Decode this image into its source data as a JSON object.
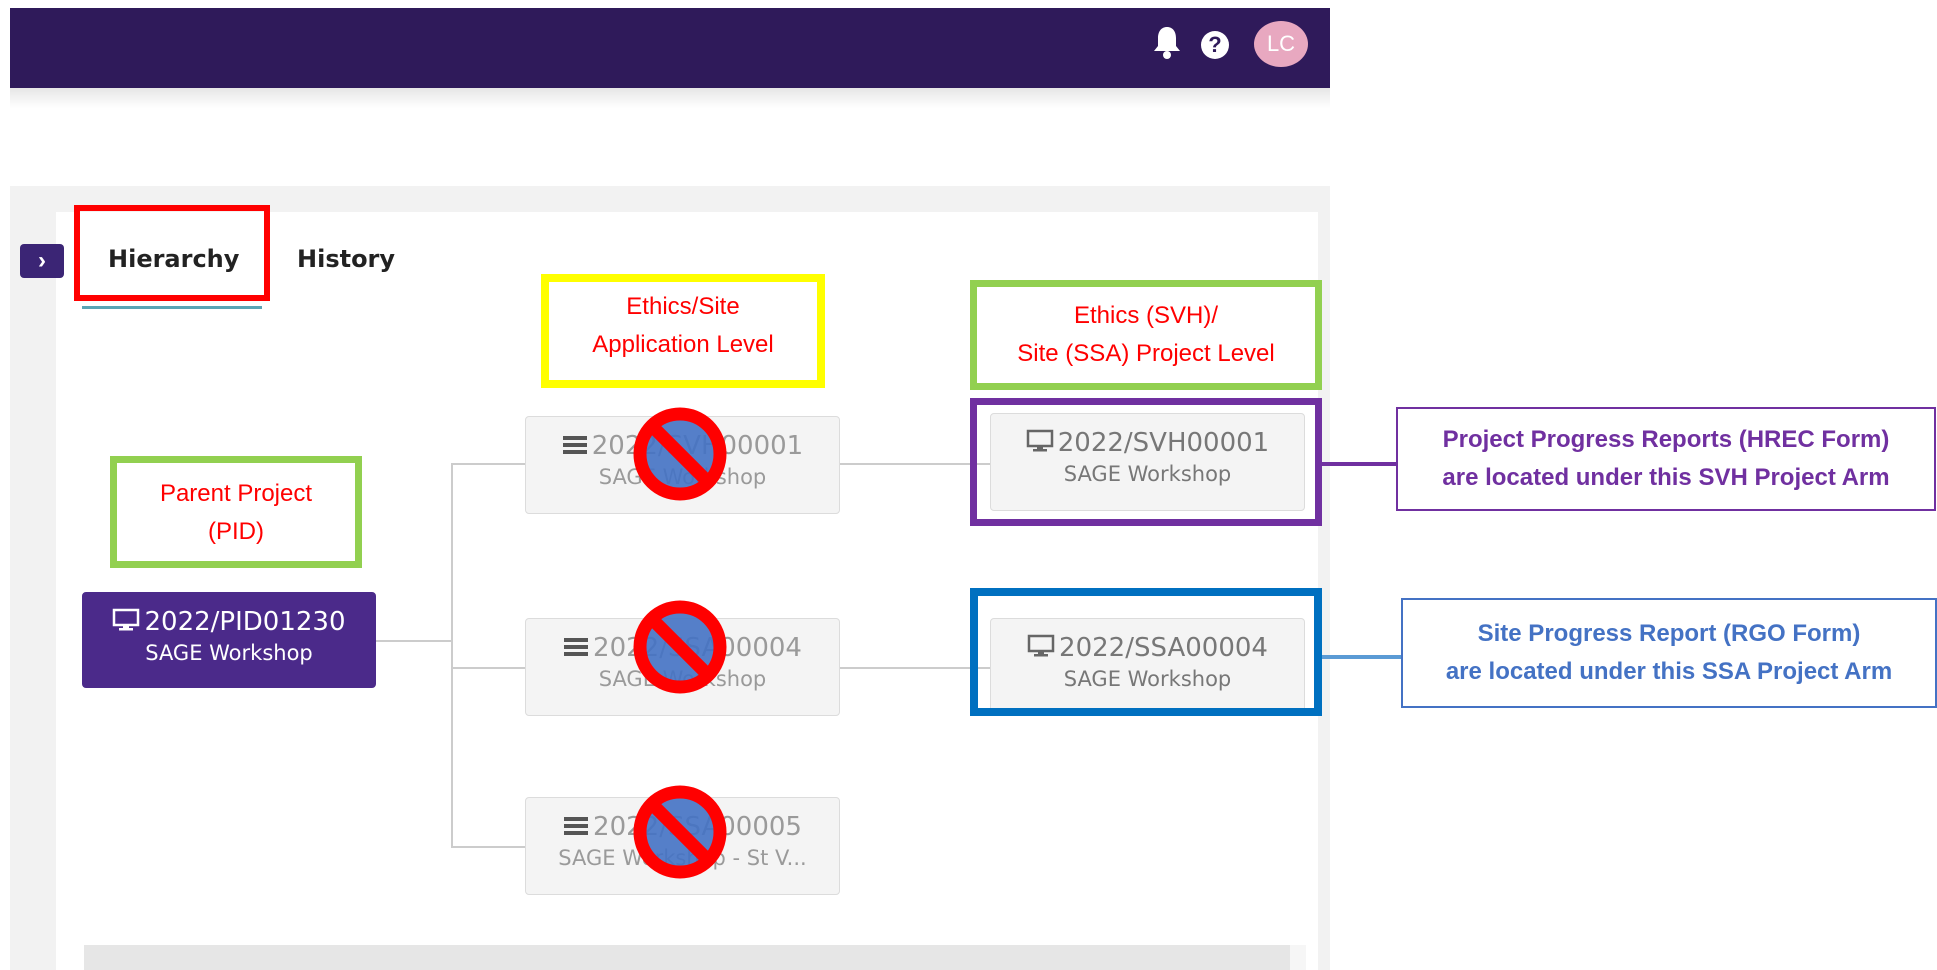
{
  "header": {
    "avatar_initials": "LC",
    "help_glyph": "?",
    "colors": {
      "bar": "#2f1a5a",
      "avatar": "#e8a8c0"
    }
  },
  "panel": {
    "expand_glyph": "›",
    "tabs": [
      {
        "label": "Hierarchy",
        "active": true
      },
      {
        "label": "History",
        "active": false
      }
    ]
  },
  "annotations": {
    "application_level": [
      "Ethics/Site",
      "Application Level"
    ],
    "project_level": [
      "Ethics (SVH)/",
      "Site (SSA) Project Level"
    ],
    "parent_project": [
      "Parent Project",
      "(PID)"
    ]
  },
  "nodes": {
    "parent": {
      "id": "2022/PID01230",
      "name": "SAGE Workshop",
      "icon": "monitor-icon"
    },
    "applications": [
      {
        "id": "2022/SVH00001",
        "name": "SAGE Workshop",
        "icon": "stack-icon",
        "crossed_out": true
      },
      {
        "id": "2022/SSA00004",
        "name": "SAGE Workshop",
        "icon": "stack-icon",
        "crossed_out": true
      },
      {
        "id": "2022/SSA00005",
        "name": "SAGE Workshop - St V...",
        "icon": "stack-icon",
        "crossed_out": true
      }
    ],
    "projects": [
      {
        "id": "2022/SVH00001",
        "name": "SAGE Workshop",
        "icon": "monitor-icon"
      },
      {
        "id": "2022/SSA00004",
        "name": "SAGE Workshop",
        "icon": "monitor-icon"
      }
    ]
  },
  "callouts": {
    "svh": [
      "Project Progress Reports (HREC Form)",
      "are located under this SVH Project Arm"
    ],
    "ssa": [
      "Site Progress Report (RGO Form)",
      "are located under this SSA Project Arm"
    ]
  },
  "highlight_colors": {
    "tab": "#ff0000",
    "application_level": "#ffff00",
    "project_level": "#92d050",
    "parent": "#92d050",
    "svh_arm": "#7030a0",
    "ssa_arm": "#0070c0"
  }
}
